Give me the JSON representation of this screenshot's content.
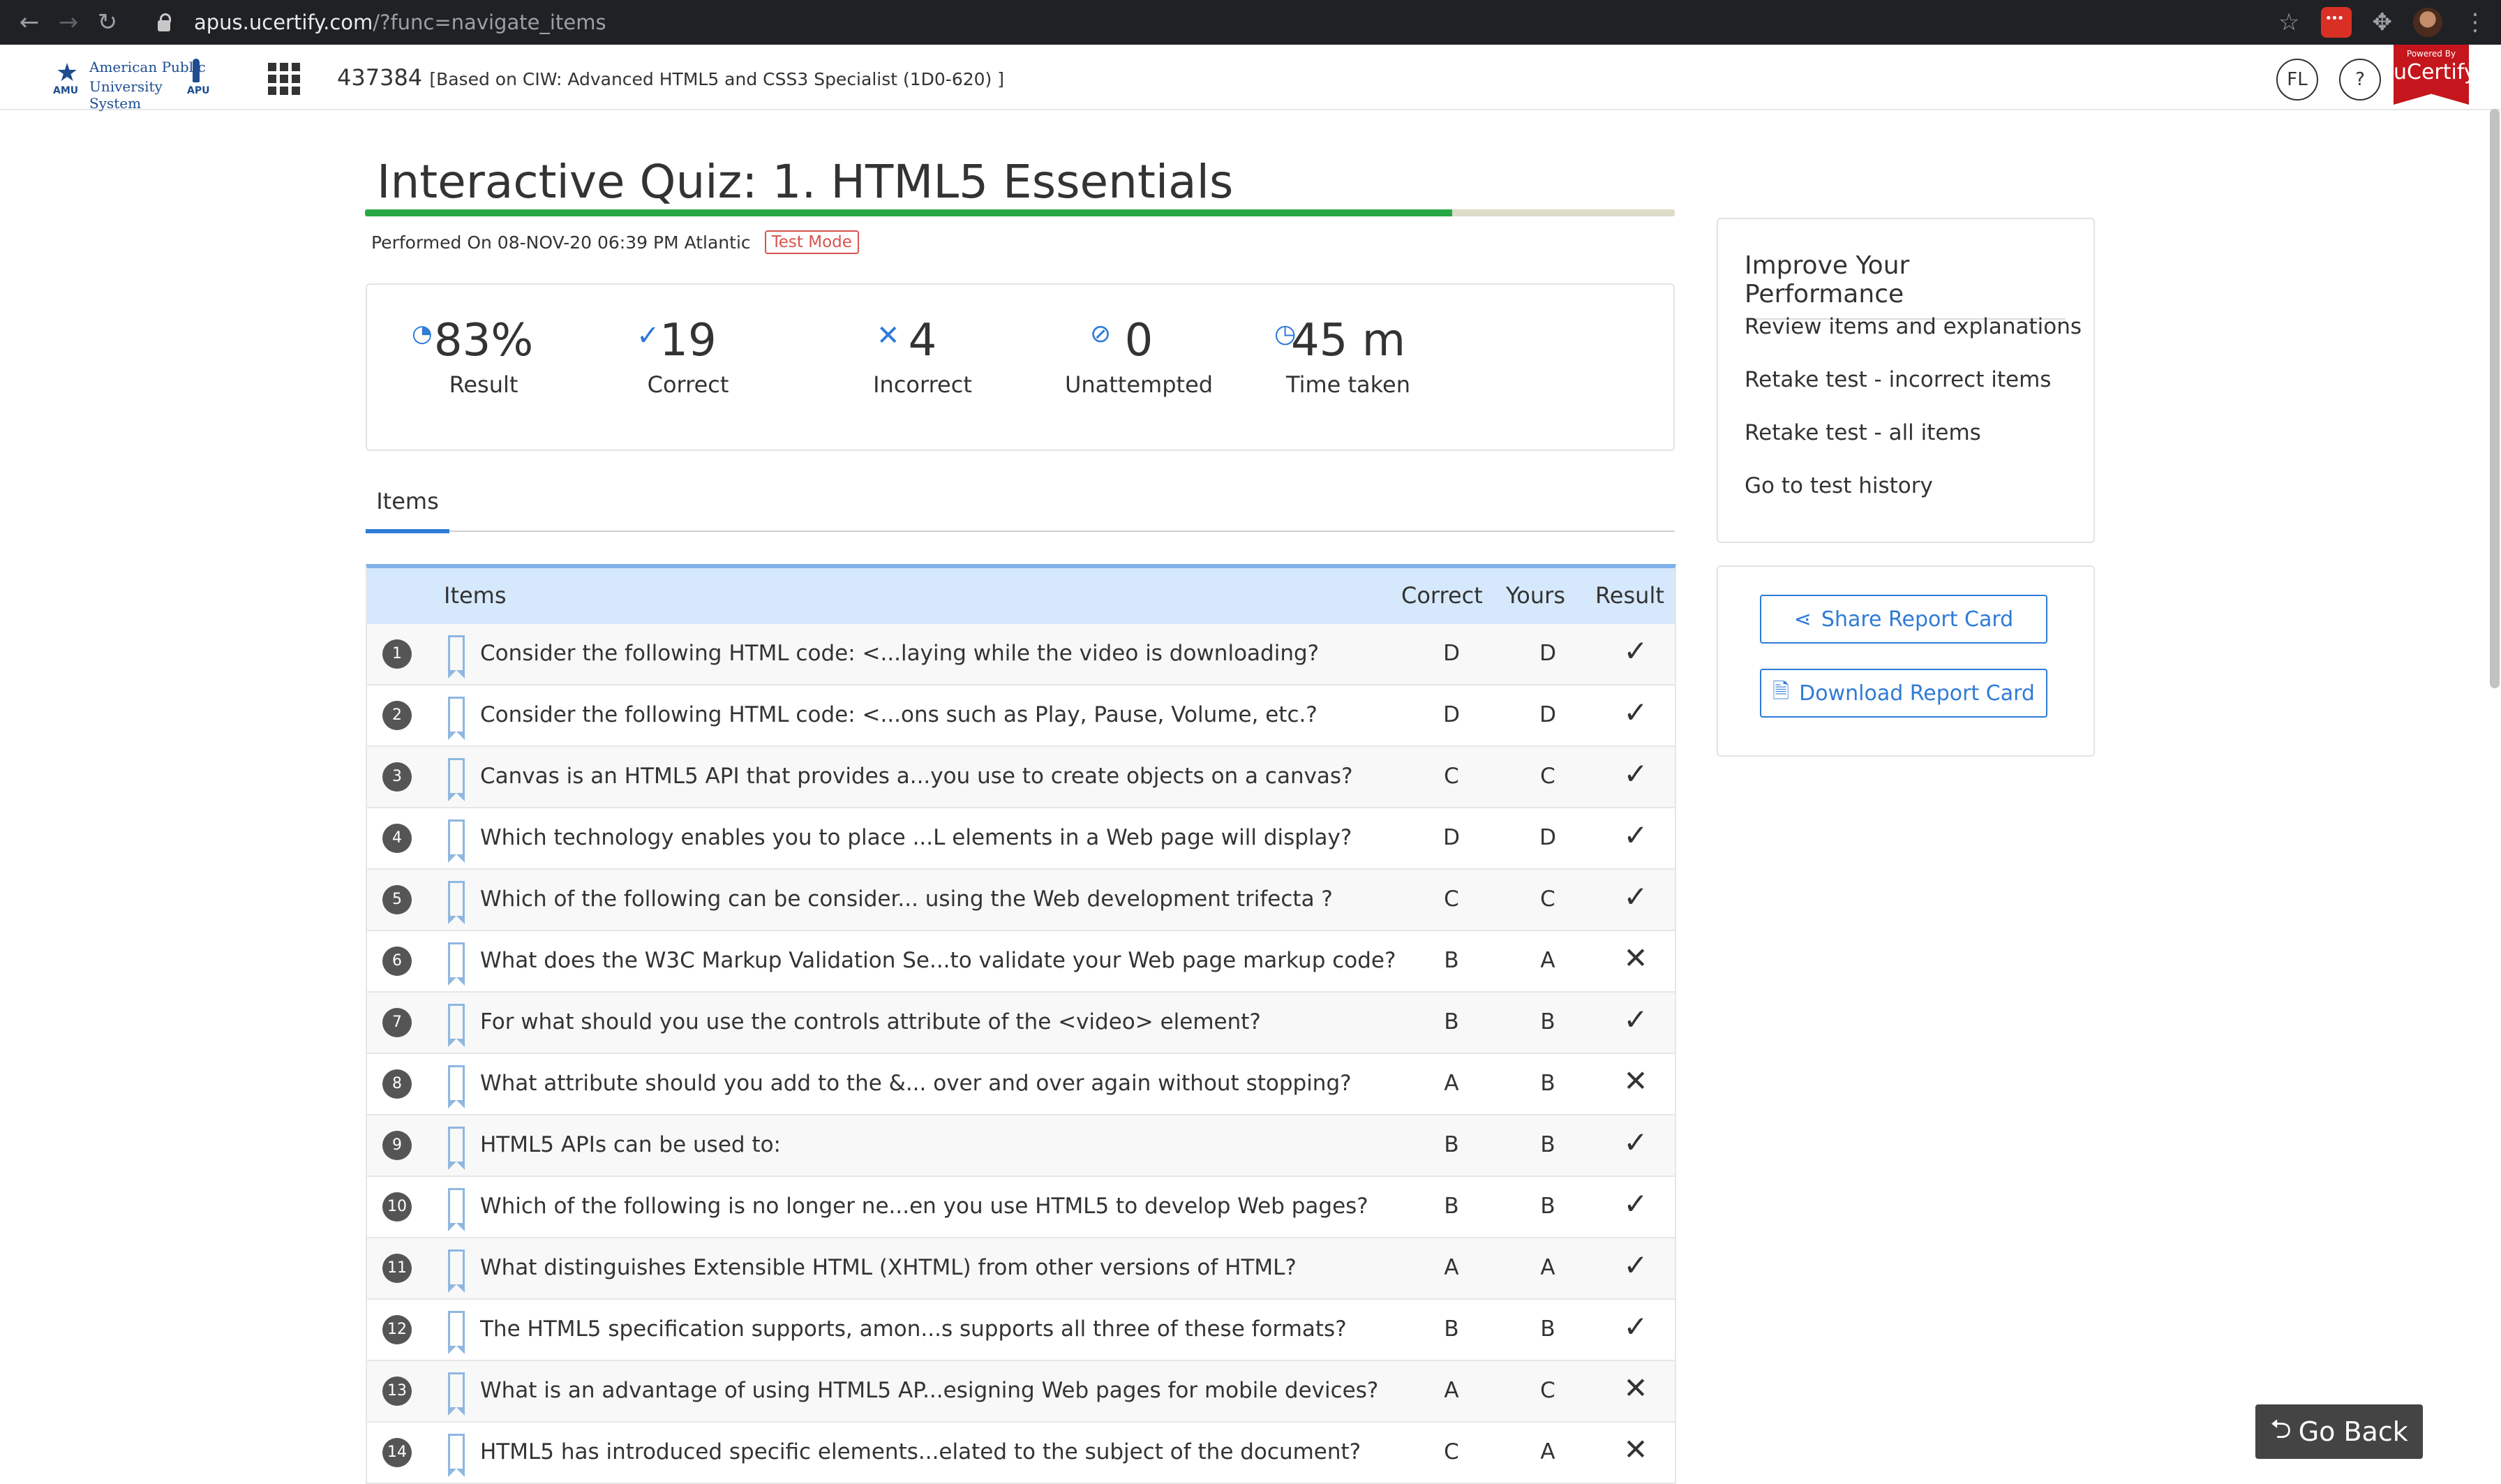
{
  "browser": {
    "url_host": "apus.ucertify.com",
    "url_path": "/?func=navigate_items"
  },
  "header": {
    "logo_line1": "American Public",
    "logo_line2": "University System",
    "logo_left": "AMU",
    "logo_right": "APU",
    "course_id": "437384",
    "course_subtitle": "[Based on CIW: Advanced HTML5 and CSS3 Specialist (1D0-620) ]",
    "user_initials": "FL",
    "help_label": "?",
    "brand_powered": "Powered By",
    "brand_name": "uCertify"
  },
  "quiz": {
    "title": "Interactive Quiz: 1. HTML5 Essentials",
    "progress_fraction": 0.83,
    "performed_on": "Performed On 08-NOV-20 06:39 PM Atlantic",
    "mode_badge": "Test Mode"
  },
  "stats": [
    {
      "icon": "result-icon",
      "value": "83%",
      "label": "Result"
    },
    {
      "icon": "check-icon",
      "value": "19",
      "label": "Correct"
    },
    {
      "icon": "cross-icon",
      "value": "4",
      "label": "Incorrect"
    },
    {
      "icon": "eye-slash-icon",
      "value": "0",
      "label": "Unattempted"
    },
    {
      "icon": "clock-icon",
      "value": "45 m",
      "label": "Time taken"
    }
  ],
  "tabs": [
    {
      "label": "Items"
    }
  ],
  "table": {
    "headers": {
      "items": "Items",
      "correct": "Correct",
      "yours": "Yours",
      "result": "Result"
    },
    "rows": [
      {
        "n": "1",
        "q": "Consider the following HTML code: <...laying while the video is downloading?",
        "correct": "D",
        "yours": "D",
        "result": "✓"
      },
      {
        "n": "2",
        "q": "Consider the following HTML code: <...ons such as Play, Pause, Volume, etc.?",
        "correct": "D",
        "yours": "D",
        "result": "✓"
      },
      {
        "n": "3",
        "q": "Canvas is an HTML5 API that provides a...you use to create objects on a canvas?",
        "correct": "C",
        "yours": "C",
        "result": "✓"
      },
      {
        "n": "4",
        "q": "Which technology enables you to place ...L elements in a Web page will display?",
        "correct": "D",
        "yours": "D",
        "result": "✓"
      },
      {
        "n": "5",
        "q": "Which of the following can be consider... using the Web development trifecta ?",
        "correct": "C",
        "yours": "C",
        "result": "✓"
      },
      {
        "n": "6",
        "q": "What does the W3C Markup Validation Se...to validate your Web page markup code?",
        "correct": "B",
        "yours": "A",
        "result": "✕"
      },
      {
        "n": "7",
        "q": "For what should you use the controls attribute of the <video> element?",
        "correct": "B",
        "yours": "B",
        "result": "✓"
      },
      {
        "n": "8",
        "q": "What attribute should you add to the &... over and over again without stopping?",
        "correct": "A",
        "yours": "B",
        "result": "✕"
      },
      {
        "n": "9",
        "q": "HTML5 APIs can be used to:",
        "correct": "B",
        "yours": "B",
        "result": "✓"
      },
      {
        "n": "10",
        "q": "Which of the following is no longer ne...en you use HTML5 to develop Web pages?",
        "correct": "B",
        "yours": "B",
        "result": "✓"
      },
      {
        "n": "11",
        "q": "What distinguishes Extensible HTML (XHTML) from other versions of HTML?",
        "correct": "A",
        "yours": "A",
        "result": "✓"
      },
      {
        "n": "12",
        "q": "The HTML5 specification supports, amon...s supports all three of these formats?",
        "correct": "B",
        "yours": "B",
        "result": "✓"
      },
      {
        "n": "13",
        "q": "What is an advantage of using HTML5 AP...esigning Web pages for mobile devices?",
        "correct": "A",
        "yours": "C",
        "result": "✕"
      },
      {
        "n": "14",
        "q": "HTML5 has introduced specific elements...elated to the subject of the document?",
        "correct": "C",
        "yours": "A",
        "result": "✕"
      }
    ]
  },
  "improve": {
    "heading": "Improve Your Performance",
    "links": [
      "Review items and explanations",
      "Retake test - incorrect items",
      "Retake test - all items",
      "Go to test history"
    ]
  },
  "report": {
    "share_label": "Share Report Card",
    "download_label": "Download Report Card"
  },
  "go_back_label": "Go Back"
}
